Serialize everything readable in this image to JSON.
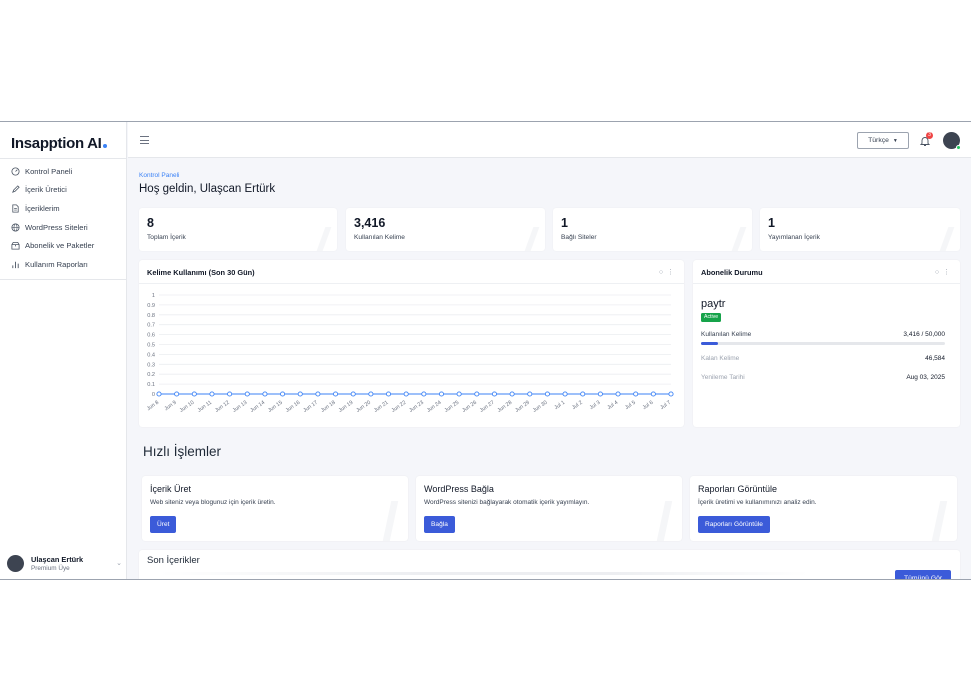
{
  "app": {
    "logo_text": "Insapption AI"
  },
  "sidebar": {
    "items": [
      {
        "label": "Kontrol Paneli",
        "icon": "dashboard-icon"
      },
      {
        "label": "İçerik Üretici",
        "icon": "pen-icon"
      },
      {
        "label": "İçeriklerim",
        "icon": "document-icon"
      },
      {
        "label": "WordPress Siteleri",
        "icon": "globe-icon"
      },
      {
        "label": "Abonelik ve Paketler",
        "icon": "package-icon"
      },
      {
        "label": "Kullanım Raporları",
        "icon": "bar-chart-icon"
      }
    ],
    "user": {
      "name": "Ulaşcan Ertürk",
      "role": "Premium Üye"
    }
  },
  "topbar": {
    "language": "Türkçe",
    "notification_count": "3"
  },
  "page": {
    "breadcrumb": "Kontrol Paneli",
    "welcome": "Hoş geldin, Ulaşcan Ertürk"
  },
  "stats": [
    {
      "value": "8",
      "label": "Toplam İçerik"
    },
    {
      "value": "3,416",
      "label": "Kullanılan Kelime"
    },
    {
      "value": "1",
      "label": "Bağlı Siteler"
    },
    {
      "value": "1",
      "label": "Yayımlanan İçerik"
    }
  ],
  "word_usage": {
    "title": "Kelime Kullanımı (Son 30 Gün)"
  },
  "chart_data": {
    "type": "line",
    "title": "Kelime Kullanımı (Son 30 Gün)",
    "categories": [
      "Jun 8",
      "Jun 9",
      "Jun 10",
      "Jun 11",
      "Jun 12",
      "Jun 13",
      "Jun 14",
      "Jun 15",
      "Jun 16",
      "Jun 17",
      "Jun 18",
      "Jun 19",
      "Jun 20",
      "Jun 21",
      "Jun 22",
      "Jun 23",
      "Jun 24",
      "Jun 25",
      "Jun 26",
      "Jun 27",
      "Jun 28",
      "Jun 29",
      "Jun 30",
      "Jul 1",
      "Jul 2",
      "Jul 3",
      "Jul 4",
      "Jul 5",
      "Jul 6",
      "Jul 7"
    ],
    "series": [
      {
        "values": [
          0,
          0,
          0,
          0,
          0,
          0,
          0,
          0,
          0,
          0,
          0,
          0,
          0,
          0,
          0,
          0,
          0,
          0,
          0,
          0,
          0,
          0,
          0,
          0,
          0,
          0,
          0,
          0,
          0,
          0
        ],
        "color": "#3b82f6"
      }
    ],
    "y_ticks": [
      "1",
      "0.9",
      "0.8",
      "0.7",
      "0.6",
      "0.5",
      "0.4",
      "0.3",
      "0.2",
      "0.1",
      "0"
    ],
    "ylim": [
      0,
      1
    ],
    "grid": true
  },
  "subscription": {
    "title": "Abonelik Durumu",
    "plan": "paytr",
    "status": "Active",
    "status_color": "#16a34a",
    "used_label": "Kullanılan Kelime",
    "used_value": "3,416 / 50,000",
    "used_fraction": 0.068,
    "remaining_label": "Kalan Kelime",
    "remaining_value": "46,584",
    "renewal_label": "Yenileme Tarihi",
    "renewal_value": "Aug 03, 2025"
  },
  "quick_actions": {
    "title": "Hızlı İşlemler",
    "items": [
      {
        "title": "İçerik Üret",
        "desc": "Web siteniz veya blogunuz için içerik üretin.",
        "button": "Üret"
      },
      {
        "title": "WordPress Bağla",
        "desc": "WordPress sitenizi bağlayarak otomatik içerik yayımlayın.",
        "button": "Bağla"
      },
      {
        "title": "Raporları Görüntüle",
        "desc": "İçerik üretimi ve kullanımınızı analiz edin.",
        "button": "Raporları Görüntüle"
      }
    ]
  },
  "recent": {
    "title": "Son İçerikler",
    "button": "Tümünü Gör"
  },
  "colors": {
    "accent": "#3b5bd9",
    "link": "#3b82f6",
    "badge": "#ef4444"
  }
}
